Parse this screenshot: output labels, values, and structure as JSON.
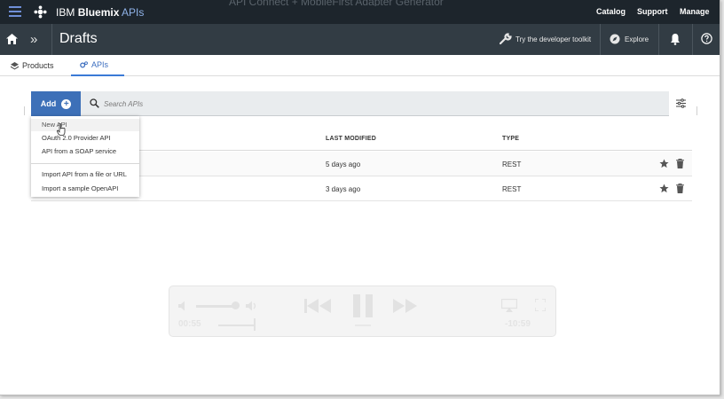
{
  "app": {
    "brand_ibm": "IBM",
    "brand_bluemix": "Bluemix",
    "brand_apis": "APIs",
    "window_title": "API Connect + MobileFirst Adapter Generator"
  },
  "topnav": {
    "catalog": "Catalog",
    "support": "Support",
    "manage": "Manage"
  },
  "subbar": {
    "page_title": "Drafts",
    "toolkit_label": "Try the developer toolkit",
    "explore_label": "Explore"
  },
  "tabs": {
    "products": "Products",
    "apis": "APIs"
  },
  "toolbar": {
    "add_label": "Add",
    "search_placeholder": "Search APIs"
  },
  "table": {
    "columns": [
      "LAST MODIFIED",
      "TYPE"
    ],
    "rows": [
      {
        "last_modified": "5 days ago",
        "type": "REST"
      },
      {
        "last_modified": "3 days ago",
        "type": "REST"
      }
    ]
  },
  "add_menu": {
    "items": [
      "New API",
      "OAuth 2.0 Provider API",
      "API from a SOAP service",
      "Import API from a file or URL",
      "Import a sample OpenAPI"
    ]
  },
  "video": {
    "elapsed": "00:55",
    "remaining": "-10:59"
  },
  "colors": {
    "topbar": "#1d252c",
    "subbar": "#323c44",
    "accent": "#3d70b8",
    "brand_apis": "#8fb2e8"
  }
}
